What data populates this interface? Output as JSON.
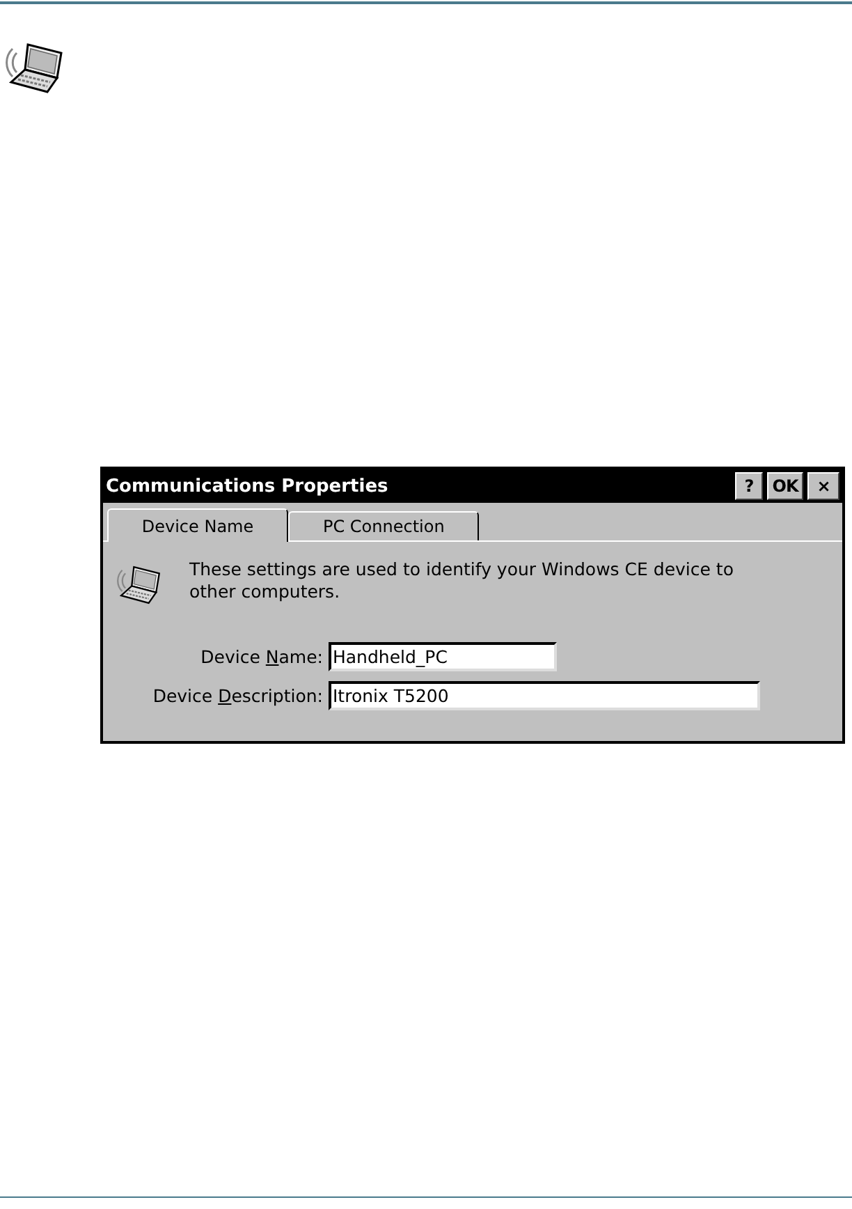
{
  "dialog": {
    "title": "Communications Properties",
    "title_buttons": [
      {
        "kind": "help",
        "label": "?"
      },
      {
        "kind": "ok",
        "label": "OK"
      },
      {
        "kind": "close",
        "label": "×"
      }
    ],
    "tabs": [
      {
        "label": "Device Name",
        "selected": true
      },
      {
        "label": "PC Connection",
        "selected": false
      }
    ],
    "description": "These settings are used to identify your Windows CE device to other computers.",
    "fields": [
      {
        "label_parts": [
          "Device ",
          "N",
          "ame:"
        ],
        "value": "Handheld_PC",
        "kind": "short"
      },
      {
        "label_parts": [
          "Device ",
          "D",
          "escription:"
        ],
        "value": "Itronix T5200",
        "kind": "long"
      }
    ]
  }
}
